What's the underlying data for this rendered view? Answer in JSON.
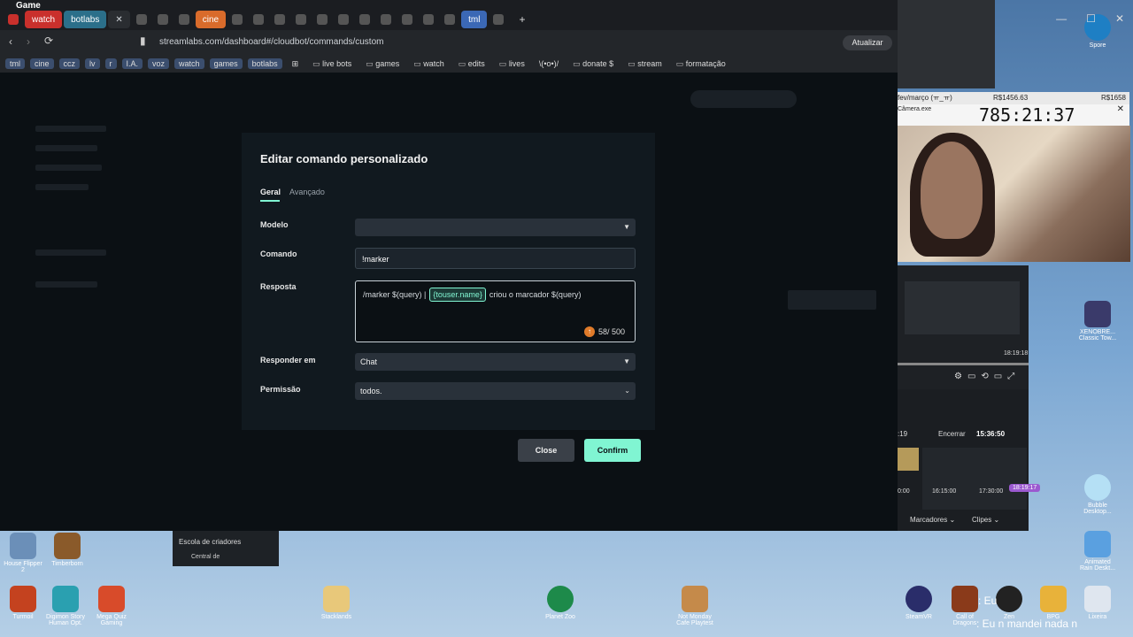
{
  "window": {
    "title": "Game"
  },
  "tabs": [
    {
      "label": "watch",
      "style": "red"
    },
    {
      "label": "botlabs",
      "style": "active"
    },
    {
      "label": "cine",
      "style": "orange"
    },
    {
      "label": "tml",
      "style": "blue"
    }
  ],
  "address": {
    "url": "streamlabs.com/dashboard#/cloudbot/commands/custom",
    "host": "streamlabs.com"
  },
  "toolbar": {
    "update_label": "Atualizar"
  },
  "bookmarks": {
    "boxed": [
      "tml",
      "cine",
      "ccz",
      "lv",
      "r",
      "I.A.",
      "voz",
      "watch",
      "games",
      "botlabs"
    ],
    "folders": [
      "live bots",
      "games",
      "watch",
      "edits",
      "lives",
      "\\(•o•)/",
      "donate $",
      "stream",
      "formatação"
    ]
  },
  "modal": {
    "title": "Editar comando personalizado",
    "tab_geral": "Geral",
    "tab_avancado": "Avançado",
    "label_modelo": "Modelo",
    "label_comando": "Comando",
    "label_resposta": "Resposta",
    "label_responder": "Responder em",
    "label_permissao": "Permissão",
    "modelo_value": "",
    "comando_value": "!marker",
    "resposta_before": "/marker $(query) |",
    "resposta_chip": "{touser.name}",
    "resposta_after": "criou o marcador $(query)",
    "char_count": "58/ 500",
    "responder_value": "Chat",
    "permissao_value": "todos.",
    "close_label": "Close",
    "confirm_label": "Confirm"
  },
  "side": {
    "cam_title_left": "fev/março (ㅠ_ㅠ)",
    "cam_title_mid": "R$1456.63",
    "cam_title_right": "R$1658",
    "cam_window": "Câmera.exe",
    "timer": "785:21:37",
    "ts_label": ":19",
    "encerrar": "Encerrar",
    "encerrar_time": "15:36:50",
    "tl_left": "0:00",
    "tl_mid": "16:15:00",
    "tl_right": "17:30:00",
    "tl_badge": "18:19:17",
    "edit_time": "18:19:18",
    "marcadores": "Marcadores ⌄",
    "clipes": "Clipes ⌄"
  },
  "taskbar": {
    "escola": "Escola de criadores",
    "central": "Central de"
  },
  "desktop_icons": [
    {
      "label": "House Flipper 2",
      "color": "#6b8fb8"
    },
    {
      "label": "Timberborn",
      "color": "#8a5a2a"
    },
    {
      "label": "Turmoil",
      "color": "#c4421f"
    },
    {
      "label": "Digimon Story Human Opt.",
      "color": "#2aa0b0"
    },
    {
      "label": "Mega Quiz Gaming",
      "color": "#d84b2a"
    },
    {
      "label": "Stacklands",
      "color": "#e8c87a"
    },
    {
      "label": "Planet Zoo",
      "color": "#1d8a4a"
    },
    {
      "label": "Not Monday Cafe Playtest",
      "color": "#c58a4a"
    },
    {
      "label": "SteamVR",
      "color": "#2a2d6a"
    },
    {
      "label": "Call of Dragons",
      "color": "#8a3a1a"
    },
    {
      "label": "Zen",
      "color": "#222222"
    },
    {
      "label": "BPG",
      "color": "#e8b23a"
    },
    {
      "label": "Lixeira",
      "color": "#dfe6ef"
    },
    {
      "label": "Animated Rain Deskt...",
      "color": "#5aa0e0"
    },
    {
      "label": "Bubble Desktop...",
      "color": "#b5e0f5"
    },
    {
      "label": "XENOBRE... Classic Tow...",
      "color": "#3a3a6a"
    },
    {
      "label": "Spore",
      "color": "#1e7fc4"
    }
  ],
  "captions": {
    "line1": ": Eu",
    "line2": ": Eu n mandei nada n"
  }
}
